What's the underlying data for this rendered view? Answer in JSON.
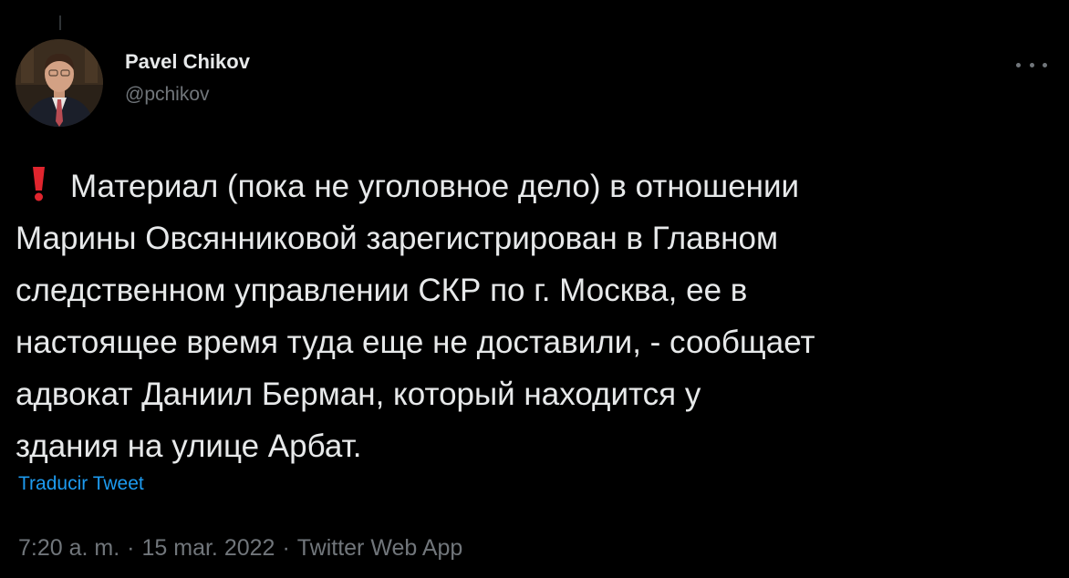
{
  "author": {
    "name": "Pavel Chikov",
    "handle": "@pchikov"
  },
  "icons": {
    "more": "more-options-icon",
    "emoji": "exclamation-mark-icon"
  },
  "colors": {
    "background": "#000000",
    "text": "#e7e9ea",
    "secondary": "#71767b",
    "link": "#1d9bf0",
    "emoji": "#e0252e"
  },
  "tweet": {
    "text": "Материал (пока не уголовное дело) в отношении\nМарины Овсянниковой зарегистрирован в Главном\nследственном управлении СКР по г. Москва, ее в\nнастоящее время туда еще не доставили, - сообщает\nадвокат Даниил Берман, который находится у\nздания на улице Арбат.",
    "translate_label": "Traducir Tweet"
  },
  "meta": {
    "time": "7:20 a. m.",
    "separator": "·",
    "date": "15 mar. 2022",
    "source": "Twitter Web App"
  }
}
